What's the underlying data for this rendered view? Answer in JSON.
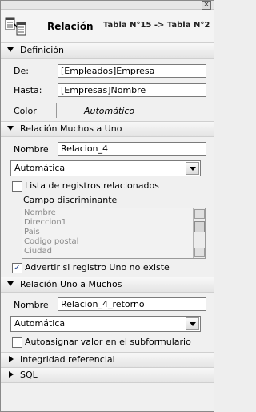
{
  "window": {
    "close_glyph": "✕"
  },
  "header": {
    "title": "Relación",
    "subtitle": "Tabla N°15 -> Tabla N°2"
  },
  "definicion": {
    "section_label": "Definición",
    "de_label": "De:",
    "de_value": "[Empleados]Empresa",
    "hasta_label": "Hasta:",
    "hasta_value": "[Empresas]Nombre",
    "color_label": "Color",
    "color_value": "Automático"
  },
  "muchos_a_uno": {
    "section_label": "Relación Muchos a Uno",
    "nombre_label": "Nombre",
    "nombre_value": "Relacion_4",
    "mode_value": "Automática",
    "lista_label": "Lista de registros relacionados",
    "lista_checked": false,
    "campo_label": "Campo discriminante",
    "campo_items": [
      "Nombre",
      "Direccion1",
      "Pais",
      "Codigo postal",
      "Ciudad"
    ],
    "advertir_label": "Advertir si registro Uno no existe",
    "advertir_checked": true
  },
  "uno_a_muchos": {
    "section_label": "Relación Uno a Muchos",
    "nombre_label": "Nombre",
    "nombre_value": "Relacion_4_retorno",
    "mode_value": "Automática",
    "auto_label": "Autoasignar valor en el subformulario",
    "auto_checked": false
  },
  "collapsed": {
    "integridad_label": "Integridad referencial",
    "sql_label": "SQL"
  },
  "colors": {
    "accent_check": "#1a3e8a",
    "section_bg": "#e4e4e4"
  }
}
